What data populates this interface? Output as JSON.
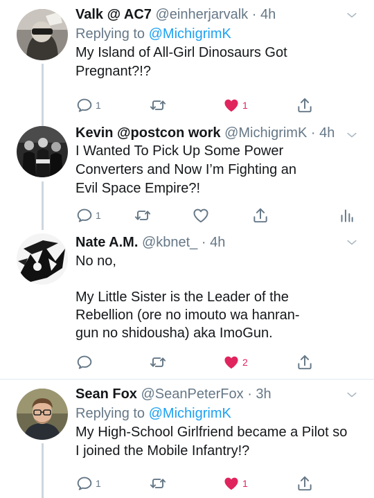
{
  "tweets": [
    {
      "name": "Valk @ AC7",
      "handle": "@einherjarvalk",
      "time": "4h",
      "replying_prefix": "Replying to",
      "replying_to": "@MichigrimK",
      "text": "My Island of All-Girl Dinosaurs Got Pregnant?!?",
      "reply_count": "1",
      "retweet_count": "",
      "like_count": "1",
      "liked": true,
      "avatar_icon": "avatar-person-icon"
    },
    {
      "name": "Kevin @postcon work",
      "handle": "@MichigrimK",
      "time": "4h",
      "text": "I Wanted To Pick Up Some Power Converters and Now I’m Fighting an Evil Space Empire?!",
      "reply_count": "1",
      "retweet_count": "",
      "like_count": "",
      "liked": false,
      "avatar_icon": "avatar-group-icon"
    },
    {
      "name": "Nate A.M.",
      "handle": "@kbnet_",
      "time": "4h",
      "text": "No no,\n\nMy Little Sister is the Leader of the Rebellion (ore no imouto wa hanran-gun no shidousha) aka ImoGun.",
      "reply_count": "",
      "retweet_count": "",
      "like_count": "2",
      "liked": true,
      "avatar_icon": "avatar-manga-icon"
    },
    {
      "name": "Sean Fox",
      "handle": "@SeanPeterFox",
      "time": "3h",
      "replying_prefix": "Replying to",
      "replying_to": "@MichigrimK",
      "text": "My High-School Girlfriend became a Pilot so I joined the Mobile Infantry!?",
      "reply_count": "1",
      "retweet_count": "",
      "like_count": "1",
      "liked": true,
      "avatar_icon": "avatar-person-glasses-icon"
    }
  ],
  "colors": {
    "name": "#14171a",
    "meta": "#657786",
    "link": "#1da1f2",
    "like": "#e0245e",
    "thread_line": "#cdd6dd",
    "separator": "#e1e8ed"
  }
}
